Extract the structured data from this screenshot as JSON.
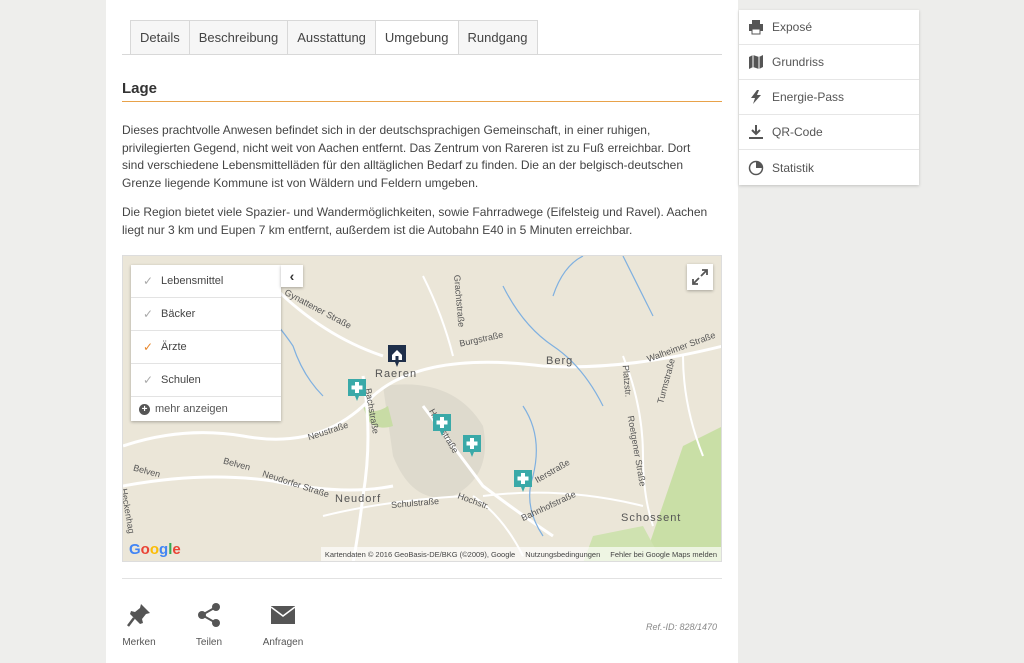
{
  "tabs": [
    {
      "label": "Details"
    },
    {
      "label": "Beschreibung"
    },
    {
      "label": "Ausstattung"
    },
    {
      "label": "Umgebung"
    },
    {
      "label": "Rundgang"
    }
  ],
  "active_tab": "Umgebung",
  "section": {
    "title": "Lage"
  },
  "paragraphs": [
    "Dieses prachtvolle Anwesen befindet sich in der deutschsprachigen Gemeinschaft, in einer ruhigen, privilegierten Gegend, nicht weit von Aachen entfernt. Das Zentrum von Rareren ist zu Fuß erreichbar. Dort sind verschiedene Lebensmittelläden für den alltäglichen Bedarf zu finden. Die an der belgisch-deutschen Grenze liegende Kommune ist von Wäldern und Feldern umgeben.",
    "Die Region bietet viele Spazier- und Wandermöglichkeiten, sowie Fahrradwege (Eifelsteig und Ravel). Aachen liegt nur 3 km und Eupen 7 km entfernt, außerdem ist die Autobahn E40 in 5 Minuten erreichbar."
  ],
  "map": {
    "poi_filters": [
      {
        "label": "Lebensmittel",
        "checked": false
      },
      {
        "label": "Bäcker",
        "checked": false
      },
      {
        "label": "Ärzte",
        "checked": true
      },
      {
        "label": "Schulen",
        "checked": false
      }
    ],
    "more_label": "mehr anzeigen",
    "labels": {
      "raeren": "Raeren",
      "berg": "Berg",
      "neudorf": "Neudorf",
      "schossent": "Schossent",
      "gynattener": "Gynattener Straße",
      "burgstrasse": "Burgstraße",
      "walheimer": "Walheimer Straße",
      "neustrasse": "Neustraße",
      "bachstrasse": "Bachstraße",
      "hauptstrasse": "Hauptstraße",
      "belven1": "Belven",
      "belven2": "Belven",
      "neudorfer": "Neudorfer Straße",
      "schulstrasse": "Schulstraße",
      "hochstr": "Hochstr.",
      "bahnhofstrasse": "Bahnhofstraße",
      "roetgener": "Roetgener Straße",
      "platzstr": "Platzstr.",
      "turmstrasse": "Turmstraße",
      "graeshaus": "Grachtstraße",
      "eckenhag": "Heckenhag",
      "sterstrasse": "Iterstraße"
    },
    "google_logo": "Google",
    "footer": {
      "attribution": "Kartendaten © 2016 GeoBasis-DE/BKG (©2009), Google",
      "terms": "Nutzungsbedingungen",
      "report": "Fehler bei Google Maps melden"
    },
    "colors": {
      "medical_marker": "#3aa9a8",
      "house_marker": "#1f2f4a",
      "check_active": "#e8872c"
    }
  },
  "actions": [
    {
      "label": "Merken",
      "icon": "pin-icon"
    },
    {
      "label": "Teilen",
      "icon": "share-icon"
    },
    {
      "label": "Anfragen",
      "icon": "mail-icon"
    }
  ],
  "ref_id": "Ref.-ID: 828/1470",
  "sidemenu": [
    {
      "label": "Exposé",
      "icon": "print-icon"
    },
    {
      "label": "Grundriss",
      "icon": "map-icon"
    },
    {
      "label": "Energie-Pass",
      "icon": "bolt-icon"
    },
    {
      "label": "QR-Code",
      "icon": "download-icon"
    },
    {
      "label": "Statistik",
      "icon": "pie-chart-icon"
    }
  ],
  "accent_color": "#e8a24a"
}
